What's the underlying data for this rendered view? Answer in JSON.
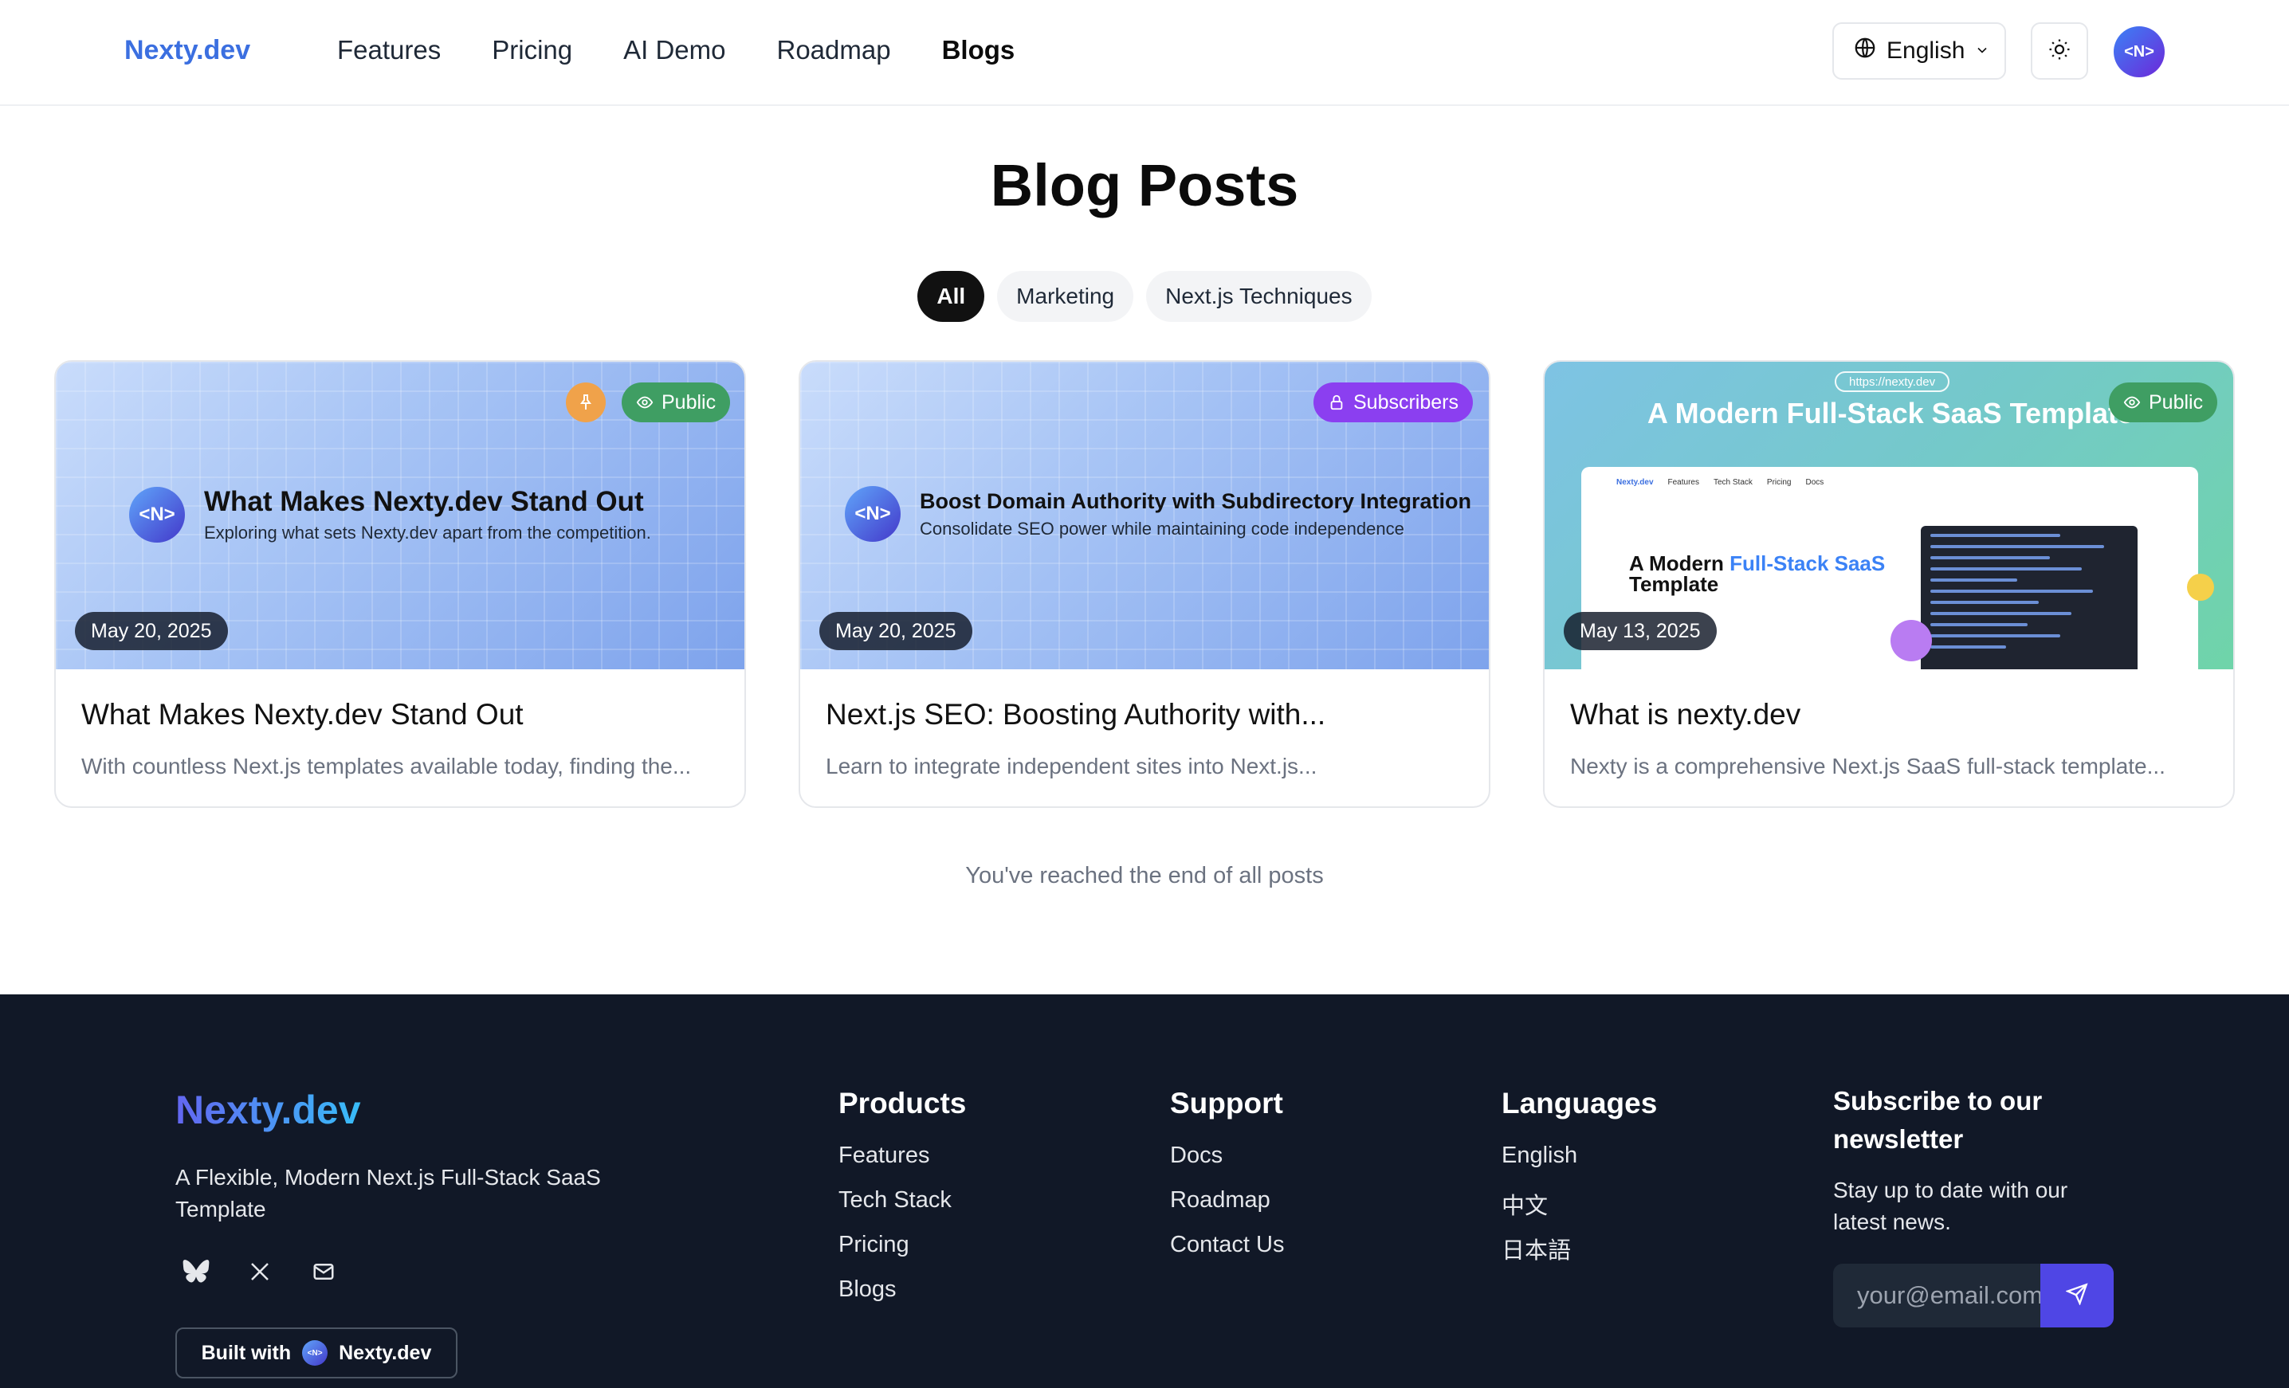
{
  "header": {
    "logo": "Nexty.dev",
    "nav": [
      {
        "label": "Features"
      },
      {
        "label": "Pricing"
      },
      {
        "label": "AI Demo"
      },
      {
        "label": "Roadmap"
      },
      {
        "label": "Blogs",
        "active": true
      }
    ],
    "language": "English",
    "avatar_text": "<N>"
  },
  "main": {
    "title": "Blog Posts",
    "filters": [
      {
        "label": "All",
        "active": true
      },
      {
        "label": "Marketing"
      },
      {
        "label": "Next.js Techniques"
      }
    ],
    "posts": [
      {
        "image_title": "What Makes Nexty.dev Stand Out",
        "image_subtitle": "Exploring what sets Nexty.dev apart from the competition.",
        "image_logo": "<N>",
        "visibility": "Public",
        "pinned": true,
        "date": "May 20, 2025",
        "title": "What Makes Nexty.dev Stand Out",
        "description": "With countless Next.js templates available today, finding the..."
      },
      {
        "image_title": "Boost Domain Authority with Subdirectory Integration",
        "image_subtitle": "Consolidate SEO power while maintaining code independence",
        "image_logo": "<N>",
        "visibility": "Subscribers",
        "pinned": false,
        "date": "May 20, 2025",
        "title": "Next.js SEO: Boosting Authority with...",
        "description": "Learn to integrate independent sites into Next.js..."
      },
      {
        "image_url": "https://nexty.dev",
        "image_title": "A Modern Full-Stack SaaS Template",
        "image_hero_plain": "A Modern",
        "image_hero_accent": "Full-Stack SaaS",
        "image_hero_last": "Template",
        "image_nav": [
          "Nexty.dev",
          "Features",
          "Tech Stack",
          "Pricing",
          "Docs"
        ],
        "visibility": "Public",
        "pinned": false,
        "date": "May 13, 2025",
        "title": "What is nexty.dev",
        "description": "Nexty is a comprehensive Next.js SaaS full-stack template..."
      }
    ],
    "end_text": "You've reached the end of all posts"
  },
  "footer": {
    "logo": "Nexty.dev",
    "tagline": "A Flexible, Modern Next.js Full-Stack SaaS Template",
    "social": [
      "bluesky-icon",
      "x-icon",
      "mail-icon"
    ],
    "built_with": {
      "prefix": "Built with",
      "brand": "Nexty.dev",
      "logo": "<N>"
    },
    "columns": [
      {
        "title": "Products",
        "links": [
          "Features",
          "Tech Stack",
          "Pricing",
          "Blogs"
        ]
      },
      {
        "title": "Support",
        "links": [
          "Docs",
          "Roadmap",
          "Contact Us"
        ]
      },
      {
        "title": "Languages",
        "links": [
          "English",
          "中文",
          "日本語"
        ]
      }
    ],
    "newsletter": {
      "title": "Subscribe to our newsletter",
      "text": "Stay up to date with our latest news.",
      "placeholder": "your@email.com"
    }
  },
  "colors": {
    "brand": "#3b6fe0",
    "public_badge": "#3f9e63",
    "subscribers_badge": "#8b3ff0",
    "pin": "#f0a24a",
    "footer_bg": "#111827",
    "send_button": "#4f46e5"
  }
}
